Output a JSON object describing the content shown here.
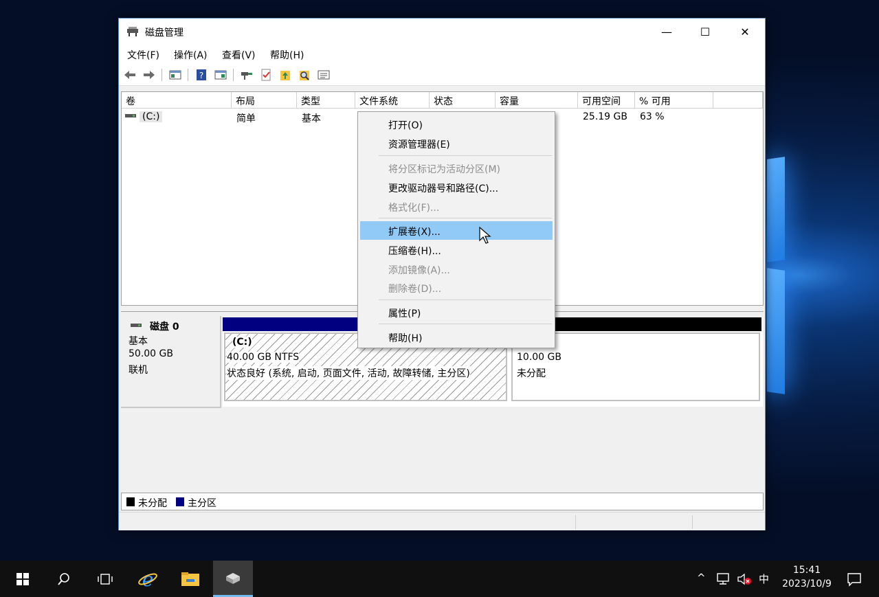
{
  "window": {
    "title": "磁盘管理",
    "controls": {
      "minimize": "—",
      "maximize": "☐",
      "close": "✕"
    }
  },
  "menubar": [
    "文件(F)",
    "操作(A)",
    "查看(V)",
    "帮助(H)"
  ],
  "volume_list": {
    "columns": [
      "卷",
      "布局",
      "类型",
      "文件系统",
      "状态",
      "容量",
      "可用空间",
      "% 可用"
    ],
    "rows": [
      {
        "volume": "(C:)",
        "layout": "简单",
        "type": "基本",
        "filesystem": "",
        "status": "",
        "capacity": "",
        "free": "25.19 GB",
        "percent_free": "63 %"
      }
    ]
  },
  "disk": {
    "name": "磁盘 0",
    "type": "基本",
    "size": "50.00 GB",
    "state": "联机",
    "partitions": [
      {
        "label": "(C:)",
        "size": "40.00 GB NTFS",
        "status": "状态良好 (系统, 启动, 页面文件, 活动, 故障转储, 主分区)"
      },
      {
        "label": "",
        "size": "10.00 GB",
        "status": "未分配"
      }
    ]
  },
  "legend": {
    "unallocated": "未分配",
    "primary": "主分区"
  },
  "context_menu": {
    "items": [
      {
        "label": "打开(O)",
        "disabled": false
      },
      {
        "label": "资源管理器(E)",
        "disabled": false
      },
      {
        "label": "将分区标记为活动分区(M)",
        "disabled": true
      },
      {
        "label": "更改驱动器号和路径(C)...",
        "disabled": false
      },
      {
        "label": "格式化(F)...",
        "disabled": true
      },
      {
        "label": "扩展卷(X)...",
        "disabled": false,
        "highlighted": true
      },
      {
        "label": "压缩卷(H)...",
        "disabled": false
      },
      {
        "label": "添加镜像(A)...",
        "disabled": true
      },
      {
        "label": "删除卷(D)...",
        "disabled": true
      },
      {
        "label": "属性(P)",
        "disabled": false
      },
      {
        "label": "帮助(H)",
        "disabled": false
      }
    ]
  },
  "taskbar": {
    "tray": {
      "chevron": "^",
      "ime": "中"
    },
    "clock": {
      "time": "15:41",
      "date": "2023/10/9"
    }
  },
  "colors": {
    "primary_partition": "#000080",
    "unallocated": "#000000",
    "menu_highlight": "#91c9f7",
    "taskbar_accent": "#76b9ed"
  }
}
